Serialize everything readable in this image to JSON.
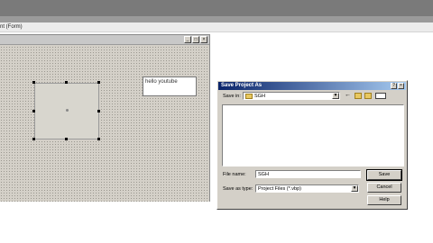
{
  "app": {
    "title": "nt (Form)"
  },
  "form": {
    "label_text": "hello youtube",
    "controls": [
      "_",
      "□",
      "×"
    ]
  },
  "dialog": {
    "title": "Save Project As",
    "title_controls": [
      "?",
      "×"
    ],
    "save_in_label": "Save in:",
    "save_in_value": "SGH",
    "file_name_label": "File name:",
    "file_name_value": "SGH",
    "save_as_type_label": "Save as type:",
    "save_as_type_value": "Project Files (*.vbp)",
    "buttons": {
      "save": "Save",
      "cancel": "Cancel",
      "help": "Help"
    },
    "arrow": "▼"
  },
  "colors": {
    "dialog_title_start": "#0a246a",
    "dialog_title_end": "#a6caf0",
    "face": "#d4d0c8"
  },
  "icons": [
    "folder-icon",
    "up-folder-icon",
    "new-folder-icon",
    "view-menu-icon",
    "back-icon"
  ]
}
